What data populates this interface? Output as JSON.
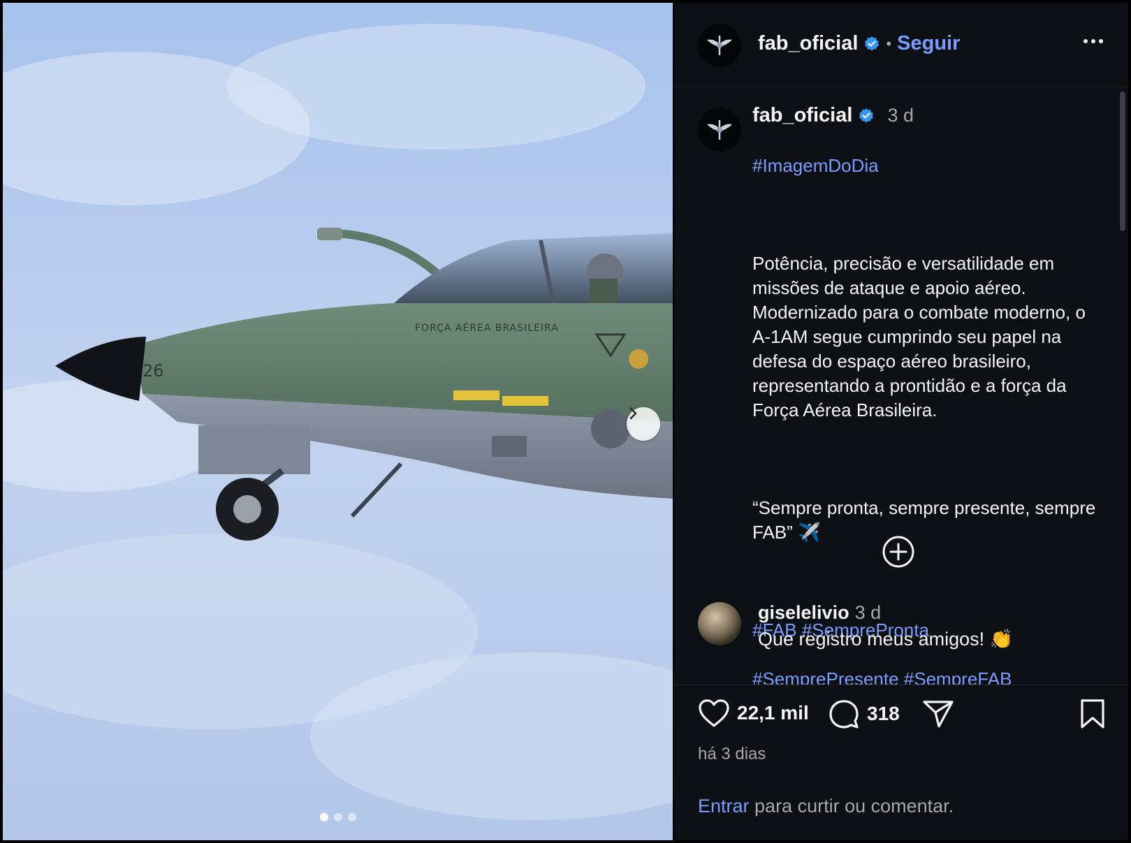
{
  "post": {
    "username": "fab_oficial",
    "verified": true,
    "follow_label": "Seguir",
    "separator": "•",
    "caption_time": "3 d",
    "caption_hashtag_top": "#ImagemDoDia",
    "caption_body": "Potência, precisão e versatilidade em missões de ataque e apoio aéreo. Modernizado para o combate moderno, o A-1AM segue cumprindo seu papel na defesa do espaço aéreo brasileiro, representando a prontidão e a força da Força Aérea Brasileira.",
    "caption_quote": "“Sempre pronta, sempre presente, sempre FAB” ✈️",
    "caption_hashtags_line1": "#FAB #SemprePronta",
    "caption_hashtags_line2": "#SemprePresente #SempreFAB"
  },
  "media": {
    "aircraft_text": "FORÇA AÉREA BRASILEIRA",
    "aircraft_number": "26",
    "carousel_total": 3,
    "carousel_index": 1
  },
  "comment": {
    "username": "giselelivio",
    "time": "3 d",
    "text": "Que registro meus amigos! 👏"
  },
  "stats": {
    "likes": "22,1 mil",
    "comments": "318",
    "posted": "há 3 dias"
  },
  "login": {
    "link": "Entrar",
    "text": " para curtir ou comentar."
  },
  "colors": {
    "panel_bg": "#0c0f14",
    "accent": "#7b9cff",
    "verified": "#3897f0",
    "muted": "#a8a8a8"
  },
  "icons": [
    "fab-emblem-icon",
    "verified-badge-icon",
    "more-options-icon",
    "chevron-right-icon",
    "add-circle-icon",
    "heart-icon",
    "comment-icon",
    "share-icon",
    "bookmark-icon"
  ]
}
